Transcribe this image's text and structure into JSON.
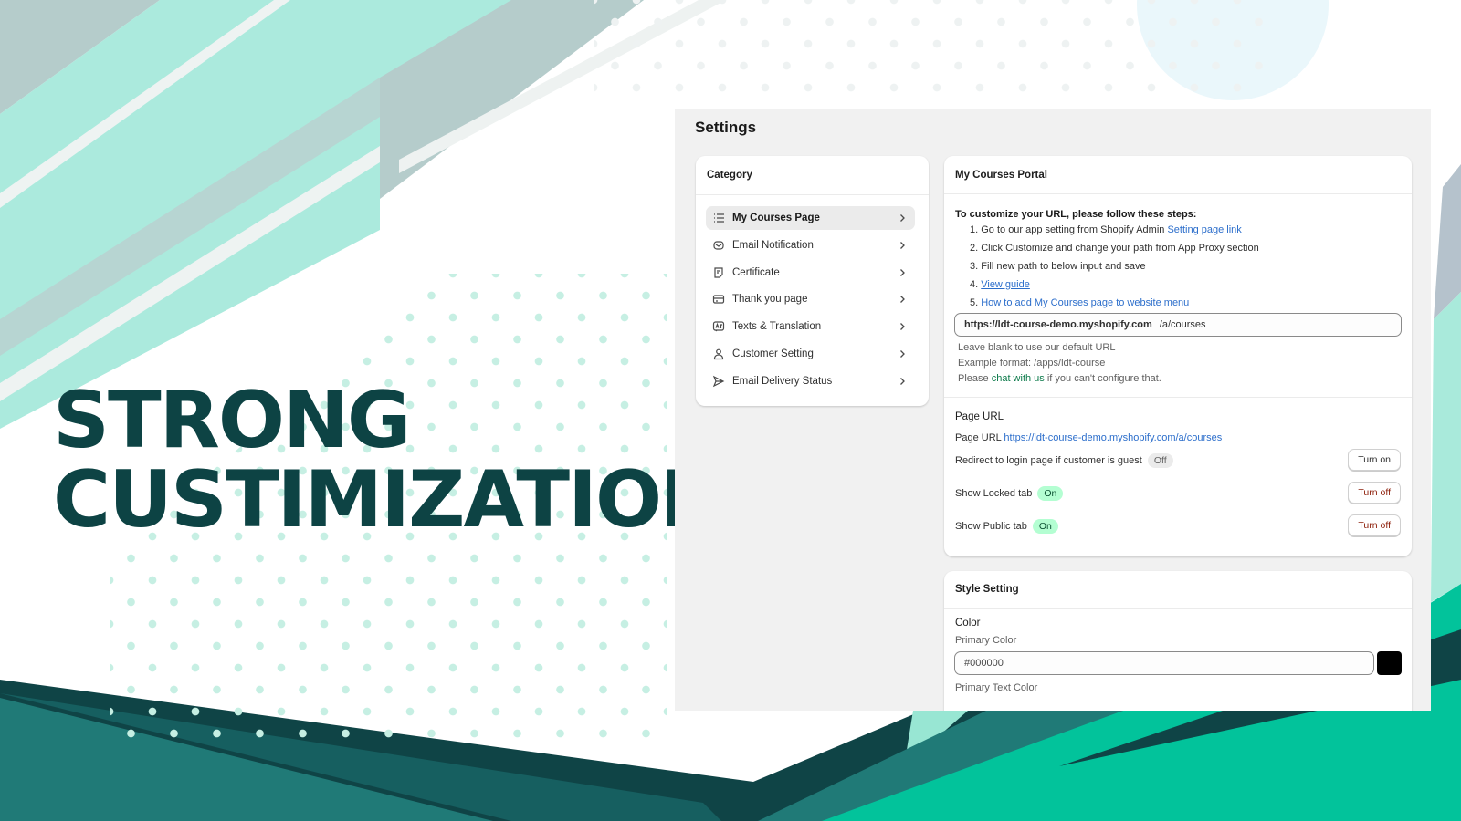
{
  "hero": {
    "line1": "STRONG",
    "line2": "CUSTIMIZATION"
  },
  "colors": {
    "dark_teal": "#0d4344",
    "mint": "#abeadd",
    "green": "#02c39b"
  },
  "settings": {
    "title": "Settings",
    "category": {
      "title": "Category",
      "items": [
        {
          "label": "My Courses Page",
          "icon": "list-icon",
          "active": true
        },
        {
          "label": "Email Notification",
          "icon": "mail-icon"
        },
        {
          "label": "Certificate",
          "icon": "note-icon"
        },
        {
          "label": "Thank you page",
          "icon": "card-icon"
        },
        {
          "label": "Texts & Translation",
          "icon": "translate-icon"
        },
        {
          "label": "Customer Setting",
          "icon": "person-icon"
        },
        {
          "label": "Email Delivery Status",
          "icon": "send-icon"
        }
      ]
    },
    "portal": {
      "title": "My Courses Portal",
      "intro": "To customize your URL, please follow these steps:",
      "step1": "1. Go to our app setting from Shopify Admin ",
      "step1_link": "Setting page link",
      "step2": "2. Click Customize and change your path from App Proxy section",
      "step3": "3. Fill new path to below input and save",
      "step4": "4. ",
      "step4_link": "View guide",
      "step5": "5. ",
      "step5_link": "How to add My Courses page to website menu",
      "url_prefix": "https://ldt-course-demo.myshopify.com",
      "url_path": "/a/courses",
      "help1": "Leave blank to use our default URL",
      "help2": "Example format: /apps/ldt-course",
      "help3a": "Please ",
      "help3_link": "chat with us",
      "help3b": " if you can't configure that.",
      "page_url_title": "Page URL",
      "page_url_label": "Page URL ",
      "page_url_link": "https://ldt-course-demo.myshopify.com/a/courses",
      "toggles": [
        {
          "label": "Redirect to login page if customer is guest",
          "status": "Off",
          "button": "Turn on"
        },
        {
          "label": "Show Locked tab",
          "status": "On",
          "button": "Turn off"
        },
        {
          "label": "Show Public tab",
          "status": "On",
          "button": "Turn off"
        }
      ]
    },
    "style": {
      "title": "Style Setting",
      "color_title": "Color",
      "primary_label": "Primary Color",
      "primary_value": "#000000",
      "primary_text_label": "Primary Text Color"
    }
  }
}
